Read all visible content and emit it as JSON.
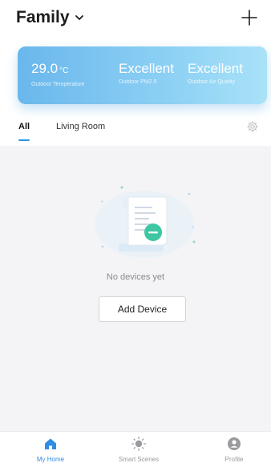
{
  "header": {
    "home_name": "Family",
    "add_icon": "plus-icon"
  },
  "weather": {
    "temperature": {
      "value": "29.0",
      "unit": "°C",
      "label": "Outdoor Temperature"
    },
    "pm25": {
      "value": "Excellent",
      "label": "Outdoor PM2.5"
    },
    "air_quality": {
      "value": "Excellent",
      "label": "Outdoor Air Quality"
    }
  },
  "room_tabs": {
    "items": [
      {
        "label": "All",
        "active": true
      },
      {
        "label": "Living Room",
        "active": false
      }
    ],
    "settings_icon": "gear-icon"
  },
  "empty_state": {
    "message": "No devices yet",
    "button_label": "Add Device"
  },
  "tabbar": {
    "items": [
      {
        "label": "My Home",
        "icon": "home-icon",
        "active": true
      },
      {
        "label": "Smart Scenes",
        "icon": "sun-icon",
        "active": false
      },
      {
        "label": "Profile",
        "icon": "profile-icon",
        "active": false
      }
    ]
  },
  "colors": {
    "accent": "#2f8de4",
    "weather_gradient_start": "#6ab7ec",
    "weather_gradient_end": "#a9e2f8",
    "empty_badge": "#3fc6a3"
  }
}
